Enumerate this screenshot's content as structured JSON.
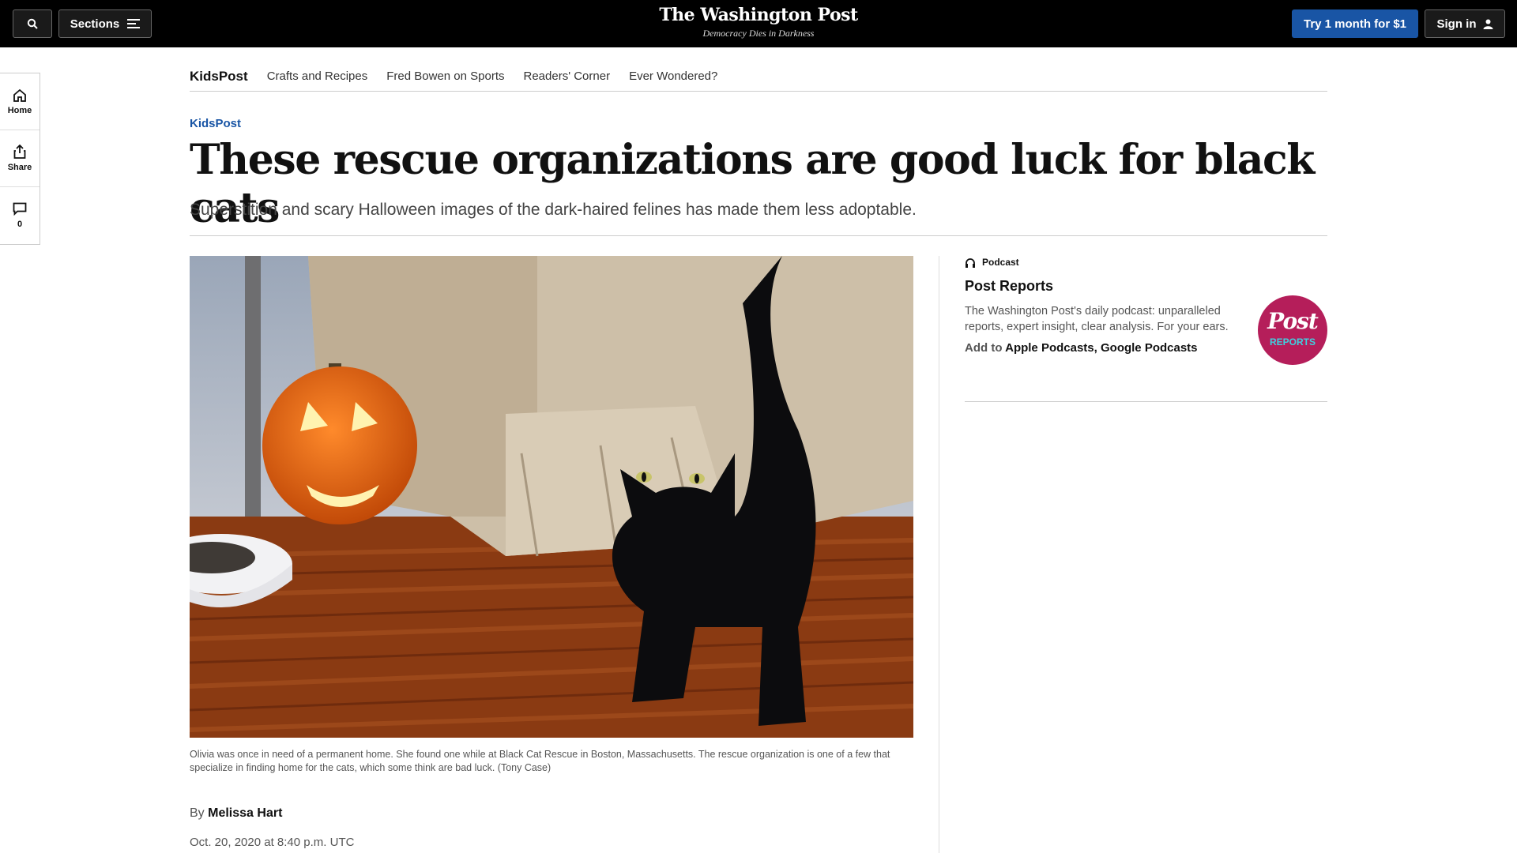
{
  "header": {
    "sections_label": "Sections",
    "logo_name": "The Washington Post",
    "logo_tagline": "Democracy Dies in Darkness",
    "subscribe_label": "Try 1 month for $1",
    "signin_label": "Sign in"
  },
  "rail": {
    "home_label": "Home",
    "share_label": "Share",
    "comment_count": "0"
  },
  "subnav": {
    "brand": "KidsPost",
    "links": [
      "Crafts and Recipes",
      "Fred Bowen on Sports",
      "Readers' Corner",
      "Ever Wondered?"
    ]
  },
  "article": {
    "kicker": "KidsPost",
    "headline": "These rescue organizations are good luck for black cats",
    "dek": "Superstition and scary Halloween images of the dark-haired felines has made them less adoptable.",
    "caption": "Olivia was once in need of a permanent home. She found one while at Black Cat Rescue in Boston, Massachusetts. The rescue organization is one of a few that specialize in finding home for the cats, which some think are bad luck. (Tony Case)",
    "byline_prefix": "By",
    "author": "Melissa Hart",
    "date": "Oct. 20, 2020 at 8:40 p.m. UTC"
  },
  "podcast": {
    "label": "Podcast",
    "title": "Post Reports",
    "description": "The Washington Post's daily podcast: unparalleled reports, expert insight, clear analysis. For your ears.",
    "add_prefix": "Add to",
    "apple": "Apple Podcasts",
    "google": "Google Podcasts",
    "logo_text": "Post",
    "logo_sub": "REPORTS"
  },
  "colors": {
    "accent": "#1955a5",
    "podcast_logo": "#b51e5a"
  }
}
